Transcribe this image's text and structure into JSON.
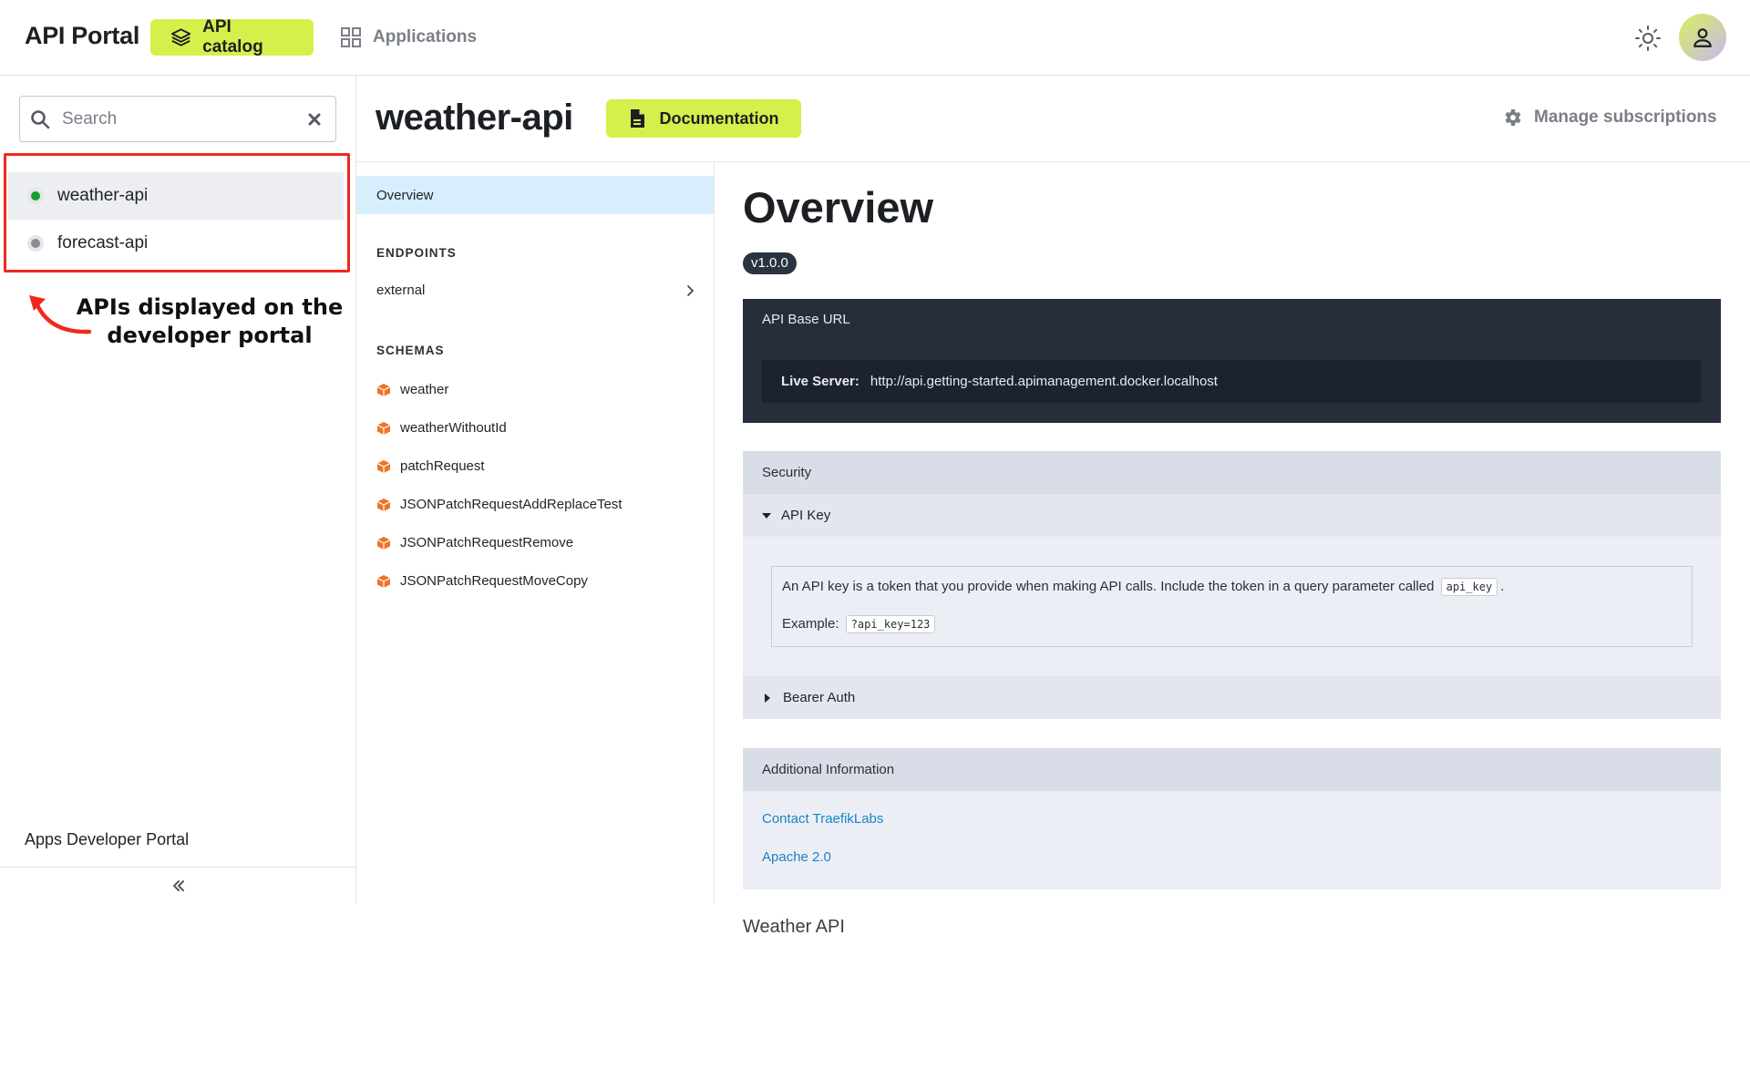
{
  "header": {
    "brand": "API Portal",
    "nav": {
      "catalog_label": "API catalog",
      "applications_label": "Applications"
    },
    "accent_color": "#d5f04a"
  },
  "sidebar": {
    "search": {
      "placeholder": "Search",
      "value": ""
    },
    "apis": [
      {
        "label": "weather-api",
        "status_color": "#1a9e2e",
        "active": true
      },
      {
        "label": "forecast-api",
        "status_color": "#8a8e94",
        "active": false
      }
    ],
    "annotation": "APIs displayed on the developer portal",
    "footer_label": "Apps Developer Portal"
  },
  "api": {
    "title": "weather-api",
    "documentation_label": "Documentation",
    "manage_label": "Manage subscriptions"
  },
  "docnav": {
    "overview_label": "Overview",
    "endpoints_heading": "ENDPOINTS",
    "endpoints": [
      "external"
    ],
    "schemas_heading": "SCHEMAS",
    "schemas": [
      "weather",
      "weatherWithoutId",
      "patchRequest",
      "JSONPatchRequestAddReplaceTest",
      "JSONPatchRequestRemove",
      "JSONPatchRequestMoveCopy"
    ]
  },
  "content": {
    "title": "Overview",
    "version": "v1.0.0",
    "base_url": {
      "label": "API Base URL",
      "server_label": "Live Server:",
      "server_url": "http://api.getting-started.apimanagement.docker.localhost"
    },
    "security": {
      "heading": "Security",
      "api_key": {
        "label": "API Key",
        "description": "An API key is a token that you provide when making API calls. Include the token in a query parameter called",
        "param": "api_key",
        "example_label": "Example:",
        "example": "?api_key=123"
      },
      "bearer_label": "Bearer Auth"
    },
    "additional": {
      "heading": "Additional Information",
      "contact": "Contact TraefikLabs",
      "license": "Apache 2.0"
    },
    "description": "Weather API"
  }
}
